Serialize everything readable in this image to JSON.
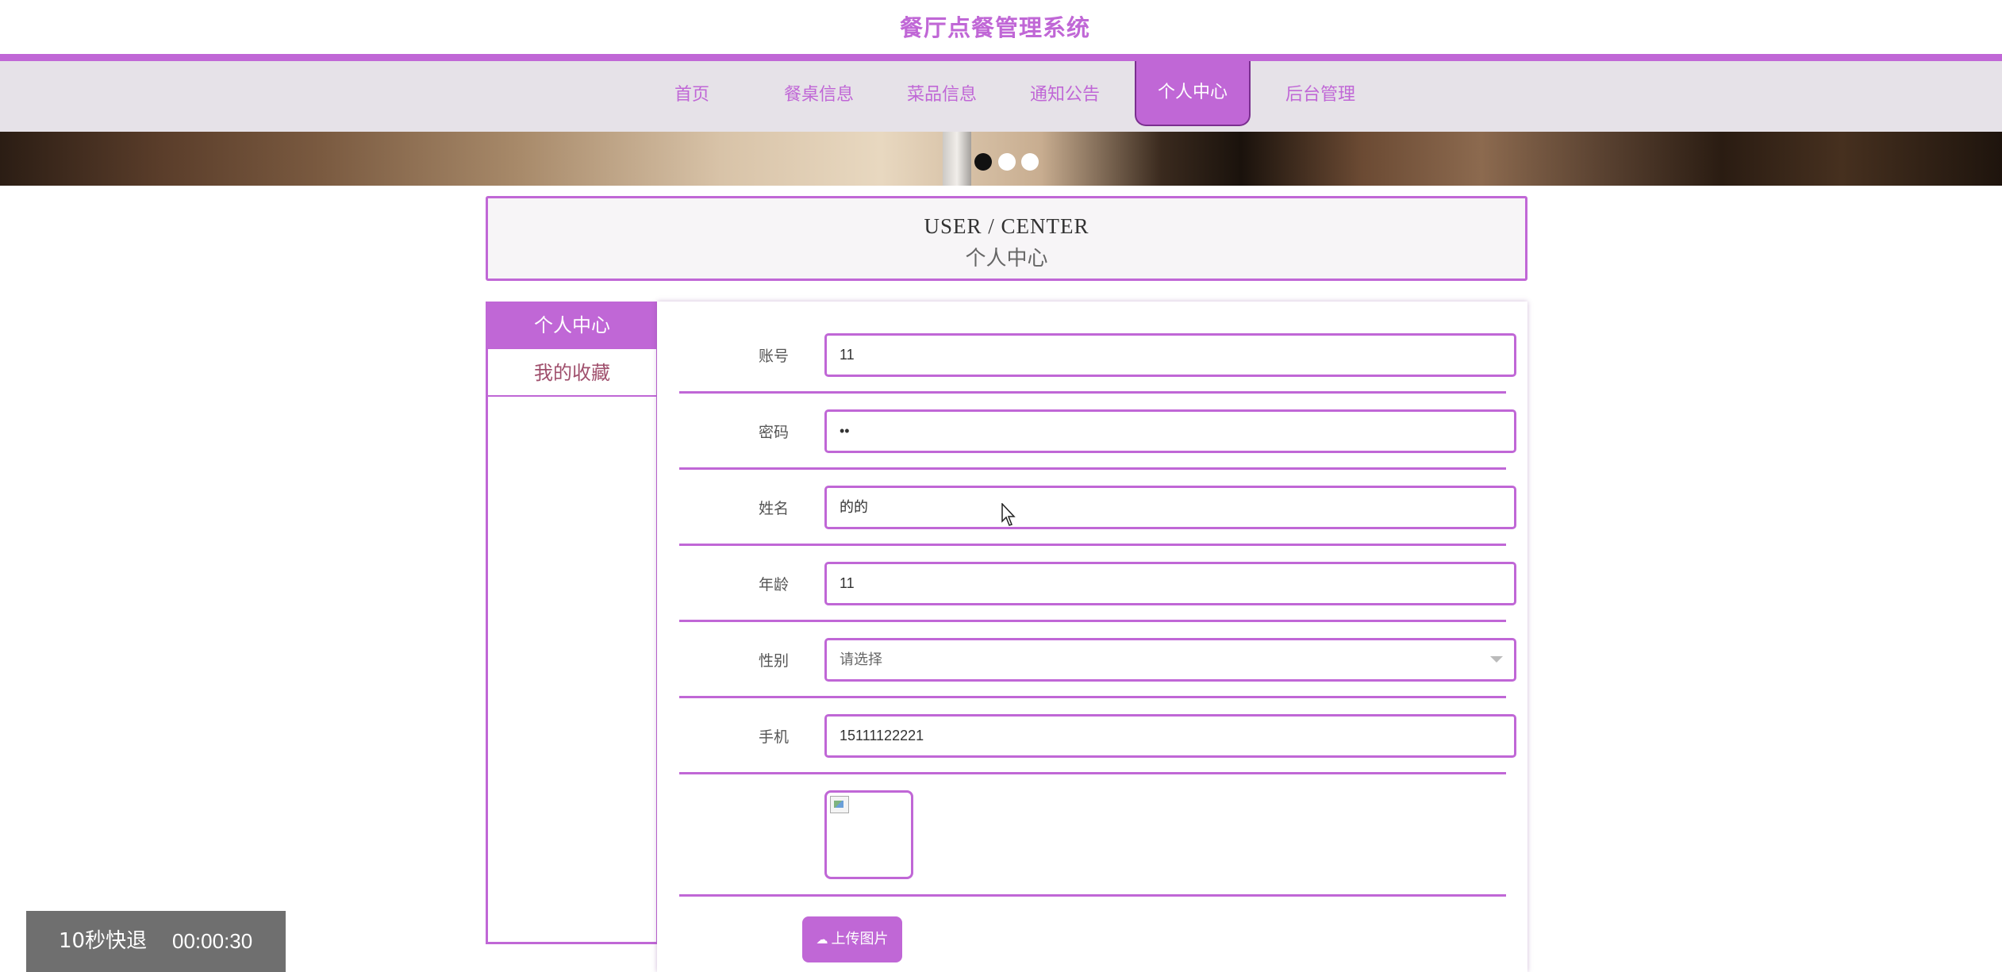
{
  "header": {
    "title": "餐厅点餐管理系统"
  },
  "nav": {
    "items": [
      "首页",
      "餐桌信息",
      "菜品信息",
      "通知公告",
      "个人中心",
      "后台管理"
    ],
    "active_index": 4
  },
  "banner": {
    "dots": [
      "dark",
      "white",
      "white"
    ]
  },
  "section": {
    "title_en": "USER / CENTER",
    "title_cn": "个人中心"
  },
  "sidebar": {
    "items": [
      "个人中心",
      "我的收藏"
    ]
  },
  "form": {
    "account": {
      "label": "账号",
      "value": "11"
    },
    "password": {
      "label": "密码",
      "value": "••"
    },
    "name": {
      "label": "姓名",
      "value": "的的"
    },
    "age": {
      "label": "年龄",
      "value": "11"
    },
    "gender": {
      "label": "性别",
      "value": "请选择"
    },
    "phone": {
      "label": "手机",
      "value": "15111122221"
    },
    "upload_label": "上传图片"
  },
  "video": {
    "rewind_label": "10秒快退",
    "time": "00:00:30"
  },
  "colors": {
    "accent": "#c067d6",
    "nav_bg": "#e6e2e8",
    "side_text": "#a0506d"
  }
}
